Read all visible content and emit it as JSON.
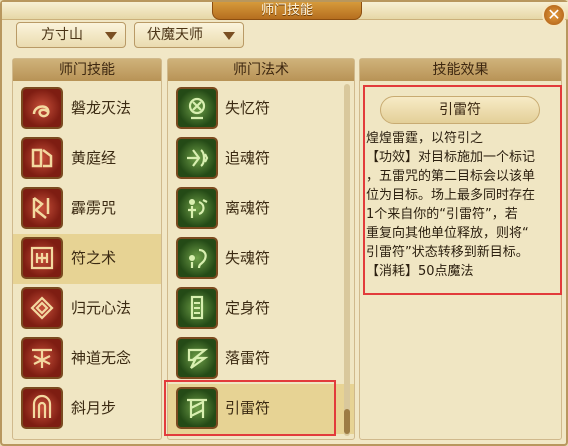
{
  "window": {
    "title": "师门技能",
    "close_symbol": "✕"
  },
  "filters": {
    "school": "方寸山",
    "master": "伏魔天师"
  },
  "skills_panel": {
    "header": "师门技能",
    "items": [
      {
        "label": "磐龙灭法",
        "icon": "dragon-coil-icon"
      },
      {
        "label": "黄庭经",
        "icon": "scroll-book-icon"
      },
      {
        "label": "霹雳咒",
        "icon": "thunder-seal-icon"
      },
      {
        "label": "符之术",
        "icon": "talisman-art-icon",
        "selected": true
      },
      {
        "label": "归元心法",
        "icon": "heart-method-icon"
      },
      {
        "label": "神道无念",
        "icon": "divine-path-icon"
      },
      {
        "label": "斜月步",
        "icon": "crescent-step-icon"
      }
    ]
  },
  "spells_panel": {
    "header": "师门法术",
    "items": [
      {
        "label": "失忆符",
        "icon": "amnesia-talisman-icon"
      },
      {
        "label": "追魂符",
        "icon": "soul-chase-talisman-icon"
      },
      {
        "label": "离魂符",
        "icon": "soul-depart-talisman-icon"
      },
      {
        "label": "失魂符",
        "icon": "soul-loss-talisman-icon"
      },
      {
        "label": "定身符",
        "icon": "binding-talisman-icon"
      },
      {
        "label": "落雷符",
        "icon": "falling-thunder-talisman-icon"
      },
      {
        "label": "引雷符",
        "icon": "lure-thunder-talisman-icon",
        "selected": true
      }
    ]
  },
  "effect_panel": {
    "header": "技能效果",
    "skill_name": "引雷符",
    "lines": [
      "煌煌雷霆，以符引之",
      "【功效】对目标施加一个标记",
      "，五雷咒的第二目标会以该单",
      "位为目标。场上最多同时存在",
      "1个来自你的“引雷符”，若",
      "重复向其他单位释放，则将“",
      "引雷符”状态转移到新目标。",
      "【消耗】50点魔法"
    ]
  },
  "colors": {
    "highlight_frame": "#e23b3b",
    "selected_row": "#e7d394"
  }
}
